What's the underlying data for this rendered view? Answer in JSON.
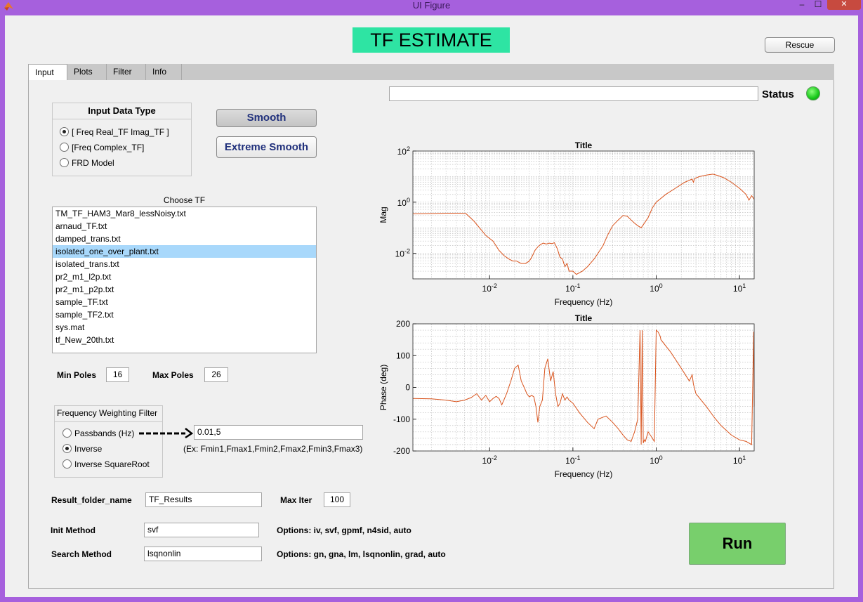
{
  "window": {
    "title": "UI Figure"
  },
  "header": {
    "title": "TF ESTIMATE",
    "rescue_label": "Rescue"
  },
  "tabs": [
    {
      "label": "Input",
      "selected": true
    },
    {
      "label": "Plots"
    },
    {
      "label": "Filter"
    },
    {
      "label": "Info"
    }
  ],
  "status": {
    "label": "Status",
    "value": "",
    "lamp_color": "#22cc22"
  },
  "data_type": {
    "title": "Input Data Type",
    "options": [
      "[ Freq Real_TF Imag_TF ]",
      "[Freq Complex_TF]",
      "FRD Model"
    ],
    "selected_index": 0
  },
  "smooth": {
    "smooth_label": "Smooth",
    "extreme_label": "Extreme Smooth"
  },
  "choose_tf": {
    "label": "Choose TF",
    "items": [
      "TM_TF_HAM3_Mar8_lessNoisy.txt",
      "arnaud_TF.txt",
      "damped_trans.txt",
      "isolated_one_over_plant.txt",
      "isolated_trans.txt",
      "pr2_m1_l2p.txt",
      "pr2_m1_p2p.txt",
      "sample_TF.txt",
      "sample_TF2.txt",
      "sys.mat",
      "tf_New_20th.txt"
    ],
    "selected_index": 3
  },
  "poles": {
    "min_label": "Min Poles",
    "min_value": "16",
    "max_label": "Max Poles",
    "max_value": "26"
  },
  "freq_weighting": {
    "title": "Frequency Weighting Filter",
    "options": [
      "Passbands (Hz)",
      "Inverse",
      "Inverse SquareRoot"
    ],
    "selected_index": 1,
    "bands_value": "0.01,5",
    "hint": "(Ex: Fmin1,Fmax1,Fmin2,Fmax2,Fmin3,Fmax3)"
  },
  "result": {
    "folder_label": "Result_folder_name",
    "folder_value": "TF_Results",
    "max_iter_label": "Max Iter",
    "max_iter_value": "100"
  },
  "init_method": {
    "label": "Init Method",
    "value": "svf",
    "options_text": "Options: iv, svf, gpmf, n4sid, auto"
  },
  "search_method": {
    "label": "Search Method",
    "value": "lsqnonlin",
    "options_text": "Options:  gn, gna, lm, lsqnonlin, grad, auto"
  },
  "run": {
    "label": "Run"
  },
  "colors": {
    "accent": "#2ee4a3",
    "run": "#78cf6c",
    "trace": "#d9531c",
    "selection": "#a8d8fb",
    "window": "#a660dd"
  },
  "chart_data": [
    {
      "type": "line",
      "title": "Title",
      "xlabel": "Frequency (Hz)",
      "ylabel": "Mag",
      "xscale": "log",
      "yscale": "log",
      "xlim": [
        0.0012,
        15
      ],
      "ylim": [
        0.001,
        100
      ],
      "x_ticks": [
        0.01,
        0.1,
        1,
        10
      ],
      "x_tick_labels": [
        [
          "10",
          "-2"
        ],
        [
          "10",
          "-1"
        ],
        [
          "10",
          "0"
        ],
        [
          "10",
          "1"
        ]
      ],
      "y_ticks": [
        0.01,
        1,
        100
      ],
      "y_tick_labels": [
        [
          "10",
          "-2"
        ],
        [
          "10",
          "0"
        ],
        [
          "10",
          "2"
        ]
      ],
      "grid": true,
      "series": [
        {
          "x": [
            0.0012,
            0.002,
            0.003,
            0.0045,
            0.0052,
            0.0065,
            0.008,
            0.009,
            0.011,
            0.013,
            0.015,
            0.017,
            0.019,
            0.021,
            0.024,
            0.027,
            0.03,
            0.032,
            0.035,
            0.038,
            0.041,
            0.044,
            0.048,
            0.052,
            0.056,
            0.06,
            0.065,
            0.07,
            0.075,
            0.08,
            0.085,
            0.09,
            0.1,
            0.11,
            0.13,
            0.15,
            0.18,
            0.2,
            0.23,
            0.26,
            0.3,
            0.35,
            0.4,
            0.45,
            0.5,
            0.55,
            0.6,
            0.66,
            0.72,
            0.8,
            0.9,
            1.0,
            1.3,
            1.7,
            2.2,
            2.7,
            2.8,
            2.9,
            3.3,
            4.0,
            4.8,
            5.5,
            6.5,
            8.0,
            10,
            12,
            13,
            14,
            15
          ],
          "y": [
            0.35,
            0.36,
            0.37,
            0.37,
            0.36,
            0.18,
            0.08,
            0.05,
            0.03,
            0.013,
            0.008,
            0.006,
            0.005,
            0.005,
            0.004,
            0.004,
            0.005,
            0.007,
            0.013,
            0.018,
            0.022,
            0.025,
            0.023,
            0.025,
            0.024,
            0.026,
            0.015,
            0.007,
            0.006,
            0.003,
            0.004,
            0.002,
            0.002,
            0.0015,
            0.002,
            0.003,
            0.006,
            0.01,
            0.02,
            0.05,
            0.12,
            0.2,
            0.3,
            0.28,
            0.2,
            0.15,
            0.12,
            0.1,
            0.15,
            0.25,
            0.6,
            1.0,
            2.0,
            3.5,
            6.0,
            8.0,
            6.0,
            8.5,
            10.0,
            11.5,
            12.5,
            11.0,
            9.0,
            6.0,
            3.5,
            2.0,
            1.2,
            1.8,
            1.3
          ]
        }
      ]
    },
    {
      "type": "line",
      "title": "Title",
      "xlabel": "Frequency (Hz)",
      "ylabel": "Phase (deg)",
      "xscale": "log",
      "xlim": [
        0.0012,
        15
      ],
      "ylim": [
        -200,
        200
      ],
      "x_ticks": [
        0.01,
        0.1,
        1,
        10
      ],
      "x_tick_labels": [
        [
          "10",
          "-2"
        ],
        [
          "10",
          "-1"
        ],
        [
          "10",
          "0"
        ],
        [
          "10",
          "1"
        ]
      ],
      "y_ticks": [
        -200,
        -100,
        0,
        100,
        200
      ],
      "y_tick_labels": [
        "-200",
        "-100",
        "0",
        "100",
        "200"
      ],
      "grid": true,
      "series": [
        {
          "x": [
            0.0012,
            0.002,
            0.003,
            0.004,
            0.005,
            0.006,
            0.007,
            0.008,
            0.009,
            0.01,
            0.011,
            0.012,
            0.013,
            0.014,
            0.016,
            0.018,
            0.02,
            0.022,
            0.024,
            0.026,
            0.028,
            0.03,
            0.032,
            0.034,
            0.036,
            0.038,
            0.04,
            0.043,
            0.046,
            0.05,
            0.054,
            0.058,
            0.062,
            0.066,
            0.07,
            0.075,
            0.08,
            0.085,
            0.09,
            0.1,
            0.12,
            0.15,
            0.18,
            0.2,
            0.25,
            0.3,
            0.35,
            0.4,
            0.45,
            0.5,
            0.55,
            0.6,
            0.64,
            0.66,
            0.68,
            0.7,
            0.72,
            0.74,
            0.8,
            0.85,
            0.9,
            0.95,
            1.0,
            1.05,
            1.1,
            1.12,
            1.14,
            1.5,
            2.0,
            2.5,
            2.7,
            2.8,
            3.0,
            4.0,
            5.0,
            6.0,
            8.0,
            10,
            12,
            14,
            14.8,
            15
          ],
          "y": [
            -35,
            -36,
            -40,
            -45,
            -40,
            -32,
            -20,
            -40,
            -25,
            -45,
            -35,
            -28,
            -35,
            -55,
            -20,
            20,
            60,
            70,
            20,
            0,
            -20,
            -30,
            -25,
            -30,
            -60,
            -110,
            -60,
            -40,
            60,
            90,
            20,
            50,
            -20,
            -60,
            -50,
            -20,
            -40,
            -30,
            -40,
            -50,
            -80,
            -110,
            -130,
            -100,
            -90,
            -110,
            -130,
            -150,
            -165,
            -170,
            -140,
            -100,
            180,
            -180,
            180,
            -175,
            -165,
            -170,
            -140,
            -150,
            -160,
            -170,
            180,
            175,
            165,
            160,
            150,
            110,
            60,
            20,
            40,
            10,
            -20,
            -60,
            -95,
            -120,
            -150,
            -165,
            -170,
            -180,
            175,
            -60
          ]
        }
      ]
    }
  ]
}
